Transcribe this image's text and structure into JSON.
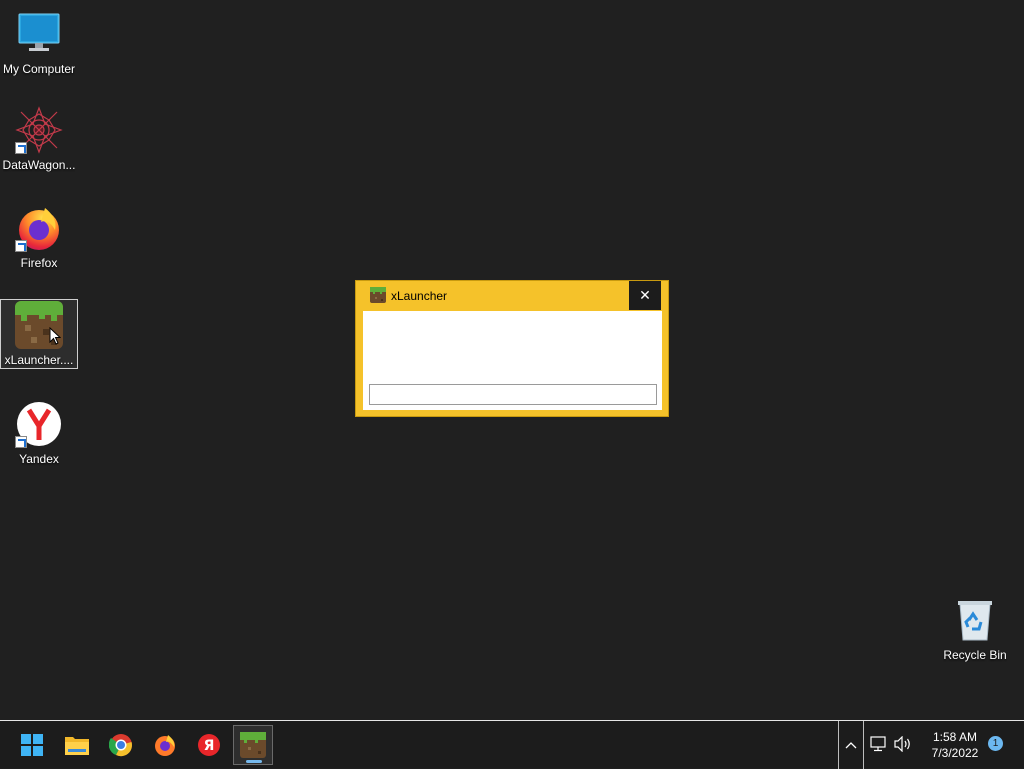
{
  "desktop": {
    "icons": [
      {
        "label": "My Computer",
        "icon": "monitor-icon"
      },
      {
        "label": "DataWagon...",
        "icon": "datawagon-icon",
        "shortcut": true
      },
      {
        "label": "Firefox",
        "icon": "firefox-icon",
        "shortcut": true
      },
      {
        "label": "xLauncher....",
        "icon": "xlauncher-icon",
        "selected": true
      },
      {
        "label": "Yandex",
        "icon": "yandex-icon",
        "shortcut": true
      }
    ],
    "recycle_bin": {
      "label": "Recycle Bin",
      "icon": "recycle-bin-icon"
    }
  },
  "dialog": {
    "title": "xLauncher",
    "close_symbol": "✕",
    "input_value": "",
    "accent": "#f5c22a"
  },
  "taskbar": {
    "items": [
      "start-icon",
      "file-explorer-icon",
      "chrome-icon",
      "firefox-icon",
      "yandex-icon",
      "xlauncher-icon"
    ],
    "active": "xlauncher-icon",
    "tray": {
      "chevron": "^",
      "time": "1:58 AM",
      "date": "7/3/2022",
      "notification_count": "1"
    }
  }
}
